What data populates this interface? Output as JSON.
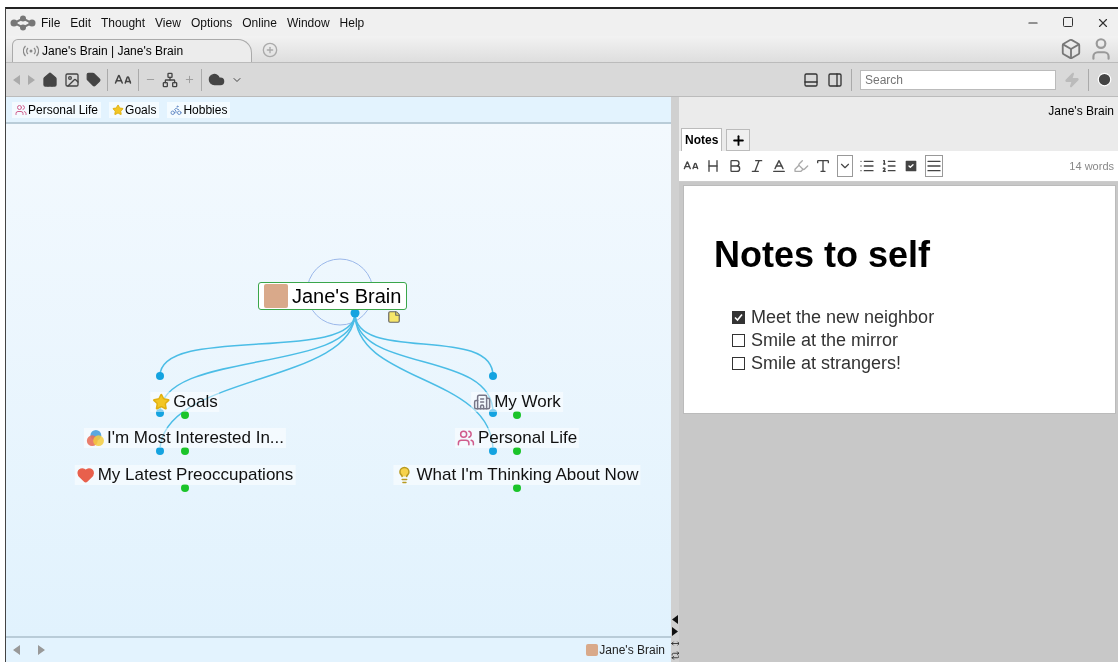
{
  "menu": [
    "File",
    "Edit",
    "Thought",
    "View",
    "Options",
    "Online",
    "Window",
    "Help"
  ],
  "tab": {
    "title": "Jane's Brain | Jane's Brain",
    "selected": true
  },
  "search": {
    "placeholder": "Search"
  },
  "pins": [
    {
      "label": "Personal Life",
      "kind": "people"
    },
    {
      "label": "Goals",
      "kind": "star"
    },
    {
      "label": "Hobbies",
      "kind": "bike"
    }
  ],
  "map": {
    "central": {
      "label": "Jane's Brain",
      "kind": "avatar",
      "has_note": true
    },
    "left_children": [
      {
        "label": "Goals",
        "kind": "star"
      },
      {
        "label": "I'm Most Interested In...",
        "kind": "circles"
      },
      {
        "label": "My Latest Preoccupations",
        "kind": "heart"
      }
    ],
    "right_children": [
      {
        "label": "My Work",
        "kind": "building"
      },
      {
        "label": "Personal Life",
        "kind": "people"
      },
      {
        "label": "What I'm Thinking About Now",
        "kind": "bulb"
      }
    ]
  },
  "footer": {
    "label": "Jane's Brain"
  },
  "notes": {
    "header": "Jane's Brain",
    "tabs": [
      {
        "label": "Notes",
        "selected": true
      }
    ],
    "word_count": "14 words",
    "title": "Notes to self",
    "checklist": [
      {
        "text": "Meet the new neighbor",
        "checked": true
      },
      {
        "text": "Smile at the mirror",
        "checked": false
      },
      {
        "text": "Smile at strangers!",
        "checked": false
      }
    ]
  }
}
